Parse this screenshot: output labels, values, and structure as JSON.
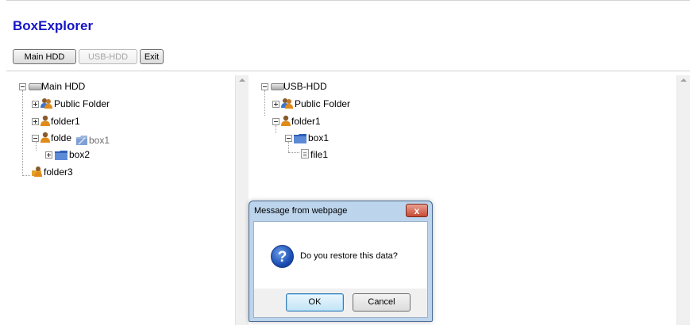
{
  "app": {
    "title": "BoxExplorer"
  },
  "toolbar": {
    "main_hdd_label": "Main HDD",
    "usb_hdd_label": "USB-HDD",
    "exit_label": "Exit"
  },
  "left_tree": {
    "root": "Main HDD",
    "public_folder": "Public Folder",
    "folder1": "folder1",
    "folder2_partial": "folde",
    "drag_ghost": "box1",
    "box2": "box2",
    "folder3": "folder3"
  },
  "right_tree": {
    "root": "USB-HDD",
    "public_folder": "Public Folder",
    "folder1": "folder1",
    "box1": "box1",
    "file1": "file1"
  },
  "dialog": {
    "title": "Message from webpage",
    "close_glyph": "x",
    "icon_glyph": "?",
    "message": "Do you restore this data?",
    "ok_label": "OK",
    "cancel_label": "Cancel"
  },
  "icons": {
    "drive": "hard-drive-icon",
    "shared": "users-folder-icon",
    "user": "user-folder-icon",
    "box": "blue-folder-icon",
    "file": "file-icon",
    "question": "question-icon"
  },
  "colors": {
    "title": "#1515c8",
    "folder_blue": "#3f73c8",
    "user_orange": "#e08a1c",
    "dialog_frame": "#bcd4ec",
    "close_red": "#c94a33"
  }
}
